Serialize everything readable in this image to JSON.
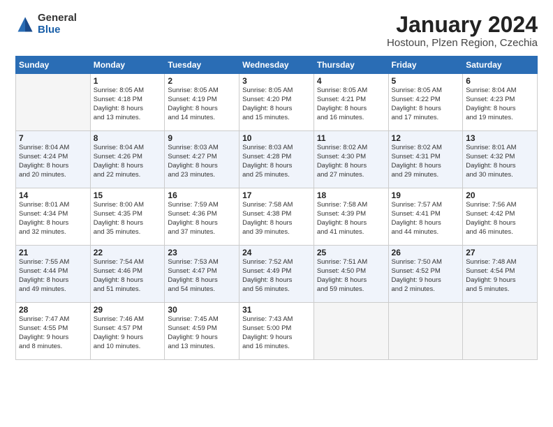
{
  "header": {
    "logo_general": "General",
    "logo_blue": "Blue",
    "title": "January 2024",
    "subtitle": "Hostoun, Plzen Region, Czechia"
  },
  "days_of_week": [
    "Sunday",
    "Monday",
    "Tuesday",
    "Wednesday",
    "Thursday",
    "Friday",
    "Saturday"
  ],
  "weeks": [
    [
      {
        "day": "",
        "content": ""
      },
      {
        "day": "1",
        "content": "Sunrise: 8:05 AM\nSunset: 4:18 PM\nDaylight: 8 hours\nand 13 minutes."
      },
      {
        "day": "2",
        "content": "Sunrise: 8:05 AM\nSunset: 4:19 PM\nDaylight: 8 hours\nand 14 minutes."
      },
      {
        "day": "3",
        "content": "Sunrise: 8:05 AM\nSunset: 4:20 PM\nDaylight: 8 hours\nand 15 minutes."
      },
      {
        "day": "4",
        "content": "Sunrise: 8:05 AM\nSunset: 4:21 PM\nDaylight: 8 hours\nand 16 minutes."
      },
      {
        "day": "5",
        "content": "Sunrise: 8:05 AM\nSunset: 4:22 PM\nDaylight: 8 hours\nand 17 minutes."
      },
      {
        "day": "6",
        "content": "Sunrise: 8:04 AM\nSunset: 4:23 PM\nDaylight: 8 hours\nand 19 minutes."
      }
    ],
    [
      {
        "day": "7",
        "content": "Sunrise: 8:04 AM\nSunset: 4:24 PM\nDaylight: 8 hours\nand 20 minutes."
      },
      {
        "day": "8",
        "content": "Sunrise: 8:04 AM\nSunset: 4:26 PM\nDaylight: 8 hours\nand 22 minutes."
      },
      {
        "day": "9",
        "content": "Sunrise: 8:03 AM\nSunset: 4:27 PM\nDaylight: 8 hours\nand 23 minutes."
      },
      {
        "day": "10",
        "content": "Sunrise: 8:03 AM\nSunset: 4:28 PM\nDaylight: 8 hours\nand 25 minutes."
      },
      {
        "day": "11",
        "content": "Sunrise: 8:02 AM\nSunset: 4:30 PM\nDaylight: 8 hours\nand 27 minutes."
      },
      {
        "day": "12",
        "content": "Sunrise: 8:02 AM\nSunset: 4:31 PM\nDaylight: 8 hours\nand 29 minutes."
      },
      {
        "day": "13",
        "content": "Sunrise: 8:01 AM\nSunset: 4:32 PM\nDaylight: 8 hours\nand 30 minutes."
      }
    ],
    [
      {
        "day": "14",
        "content": "Sunrise: 8:01 AM\nSunset: 4:34 PM\nDaylight: 8 hours\nand 32 minutes."
      },
      {
        "day": "15",
        "content": "Sunrise: 8:00 AM\nSunset: 4:35 PM\nDaylight: 8 hours\nand 35 minutes."
      },
      {
        "day": "16",
        "content": "Sunrise: 7:59 AM\nSunset: 4:36 PM\nDaylight: 8 hours\nand 37 minutes."
      },
      {
        "day": "17",
        "content": "Sunrise: 7:58 AM\nSunset: 4:38 PM\nDaylight: 8 hours\nand 39 minutes."
      },
      {
        "day": "18",
        "content": "Sunrise: 7:58 AM\nSunset: 4:39 PM\nDaylight: 8 hours\nand 41 minutes."
      },
      {
        "day": "19",
        "content": "Sunrise: 7:57 AM\nSunset: 4:41 PM\nDaylight: 8 hours\nand 44 minutes."
      },
      {
        "day": "20",
        "content": "Sunrise: 7:56 AM\nSunset: 4:42 PM\nDaylight: 8 hours\nand 46 minutes."
      }
    ],
    [
      {
        "day": "21",
        "content": "Sunrise: 7:55 AM\nSunset: 4:44 PM\nDaylight: 8 hours\nand 49 minutes."
      },
      {
        "day": "22",
        "content": "Sunrise: 7:54 AM\nSunset: 4:46 PM\nDaylight: 8 hours\nand 51 minutes."
      },
      {
        "day": "23",
        "content": "Sunrise: 7:53 AM\nSunset: 4:47 PM\nDaylight: 8 hours\nand 54 minutes."
      },
      {
        "day": "24",
        "content": "Sunrise: 7:52 AM\nSunset: 4:49 PM\nDaylight: 8 hours\nand 56 minutes."
      },
      {
        "day": "25",
        "content": "Sunrise: 7:51 AM\nSunset: 4:50 PM\nDaylight: 8 hours\nand 59 minutes."
      },
      {
        "day": "26",
        "content": "Sunrise: 7:50 AM\nSunset: 4:52 PM\nDaylight: 9 hours\nand 2 minutes."
      },
      {
        "day": "27",
        "content": "Sunrise: 7:48 AM\nSunset: 4:54 PM\nDaylight: 9 hours\nand 5 minutes."
      }
    ],
    [
      {
        "day": "28",
        "content": "Sunrise: 7:47 AM\nSunset: 4:55 PM\nDaylight: 9 hours\nand 8 minutes."
      },
      {
        "day": "29",
        "content": "Sunrise: 7:46 AM\nSunset: 4:57 PM\nDaylight: 9 hours\nand 10 minutes."
      },
      {
        "day": "30",
        "content": "Sunrise: 7:45 AM\nSunset: 4:59 PM\nDaylight: 9 hours\nand 13 minutes."
      },
      {
        "day": "31",
        "content": "Sunrise: 7:43 AM\nSunset: 5:00 PM\nDaylight: 9 hours\nand 16 minutes."
      },
      {
        "day": "",
        "content": ""
      },
      {
        "day": "",
        "content": ""
      },
      {
        "day": "",
        "content": ""
      }
    ]
  ]
}
